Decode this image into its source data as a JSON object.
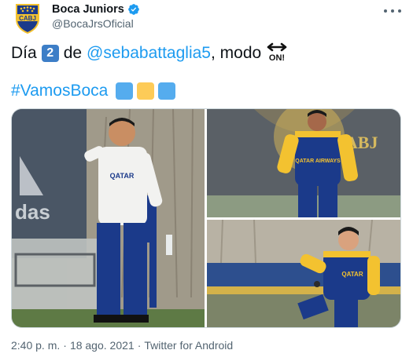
{
  "author": {
    "name": "Boca Juniors",
    "handle": "@BocaJrsOficial",
    "avatar_text": "CABJ",
    "verified_icon": "verified-badge-icon"
  },
  "tweet": {
    "text_prefix": "Día",
    "keycap_number": "2",
    "text_de": "de",
    "mention": "@sebabattaglia5",
    "text_modo": ", modo",
    "on_emoji_text": "ON!",
    "hashtag": "#VamosBoca",
    "color_squares": [
      "#55acee",
      "#fdcb58",
      "#55acee"
    ]
  },
  "media": {
    "photos": [
      {
        "name": "photo-coach",
        "shirt_text": "QATAR"
      },
      {
        "name": "photo-player-running",
        "shirt_text": "QATAR AIRWAYS",
        "wall_text": "CABJ"
      },
      {
        "name": "photo-player-dribbling",
        "shirt_text": "QATAR"
      }
    ]
  },
  "meta": {
    "time": "2:40 p. m.",
    "separator": "·",
    "date": "18 ago. 2021",
    "source": "Twitter for Android"
  },
  "colors": {
    "accent": "#1d9bf0",
    "boca_blue": "#1b3a8a",
    "boca_yellow": "#f3c230"
  }
}
